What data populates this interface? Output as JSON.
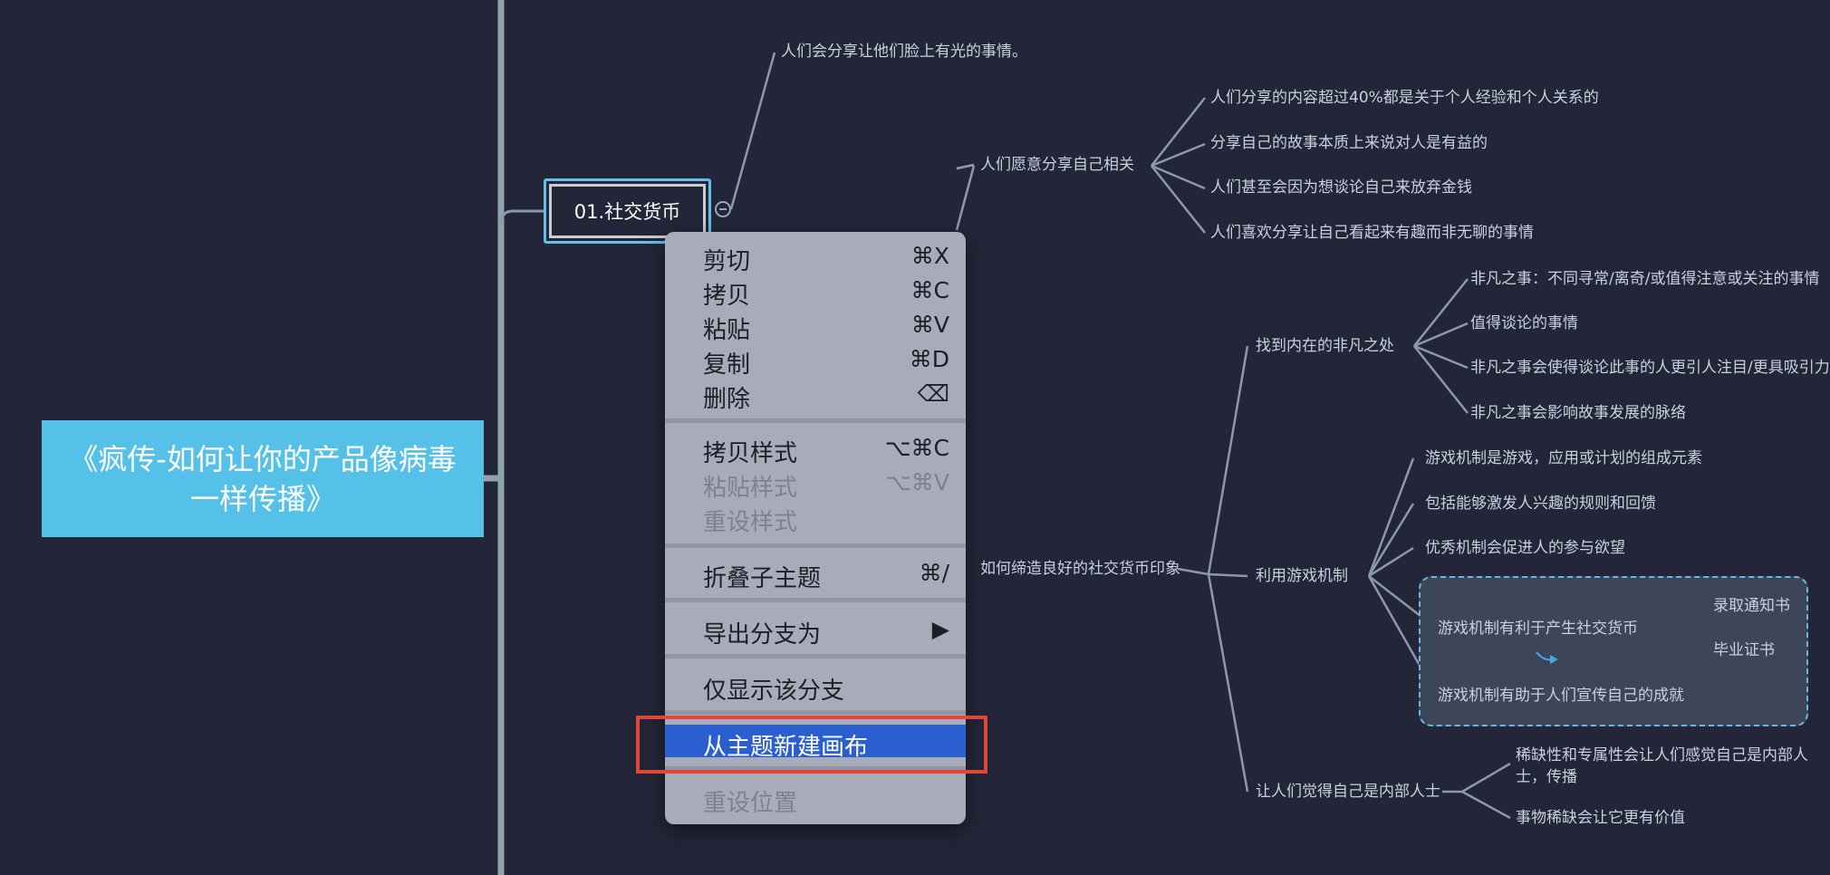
{
  "root": {
    "title": "《疯传-如何让你的产品像病毒一样传播》"
  },
  "topic": {
    "label": "01.社交货币"
  },
  "nodes": {
    "n1": "人们会分享让他们脸上有光的事情。",
    "self_share": "人们愿意分享自己相关",
    "self_1": "人们分享的内容超过40%都是关于个人经验和个人关系的",
    "self_2": "分享自己的故事本质上来说对人是有益的",
    "self_3": "人们甚至会因为想谈论自己来放弃金钱",
    "self_4": "人们喜欢分享让自己看起来有趣而非无聊的事情",
    "impression": "如何缔造良好的社交货币印象",
    "find_extra": "找到内在的非凡之处",
    "extra_1": "非凡之事：不同寻常/离奇/或值得注意或关注的事情",
    "extra_2": "值得谈论的事情",
    "extra_3": "非凡之事会使得谈论此事的人更引人注目/更具吸引力",
    "extra_4": "非凡之事会影响故事发展的脉络",
    "game": "利用游戏机制",
    "game_1": "游戏机制是游戏，应用或计划的组成元素",
    "game_2": "包括能够激发人兴趣的规则和回馈",
    "game_3": "优秀机制会促进人的参与欲望",
    "game_4": "游戏机制有利于产生社交货币",
    "game_4a": "录取通知书",
    "game_4b": "毕业证书",
    "game_5": "游戏机制有助于人们宣传自己的成就",
    "insider": "让人们觉得自己是内部人士",
    "insider_1": "稀缺性和专属性会让人们感觉自己是内部人士，传播",
    "insider_2": "事物稀缺会让它更有价值"
  },
  "menu": {
    "cut": {
      "label": "剪切",
      "shortcut": "⌘X"
    },
    "copy": {
      "label": "拷贝",
      "shortcut": "⌘C"
    },
    "paste": {
      "label": "粘贴",
      "shortcut": "⌘V"
    },
    "duplicate": {
      "label": "复制",
      "shortcut": "⌘D"
    },
    "delete": {
      "label": "删除",
      "shortcut": "⌫"
    },
    "copy_style": {
      "label": "拷贝样式",
      "shortcut": "⌥⌘C"
    },
    "paste_style": {
      "label": "粘贴样式",
      "shortcut": "⌥⌘V"
    },
    "reset_style": {
      "label": "重设样式"
    },
    "collapse": {
      "label": "折叠子主题",
      "shortcut": "⌘/"
    },
    "export": {
      "label": "导出分支为",
      "shortcut": "▶"
    },
    "only_show": {
      "label": "仅显示该分支"
    },
    "new_canvas": {
      "label": "从主题新建画布"
    },
    "reset_position": {
      "label": "重设位置"
    }
  },
  "colors": {
    "background": "#232638",
    "root": "#55c1e9",
    "line": "#8b9aaa",
    "menu": "#a8abb9",
    "selected": "#2b5fd0",
    "highlight": "#e0463a"
  }
}
